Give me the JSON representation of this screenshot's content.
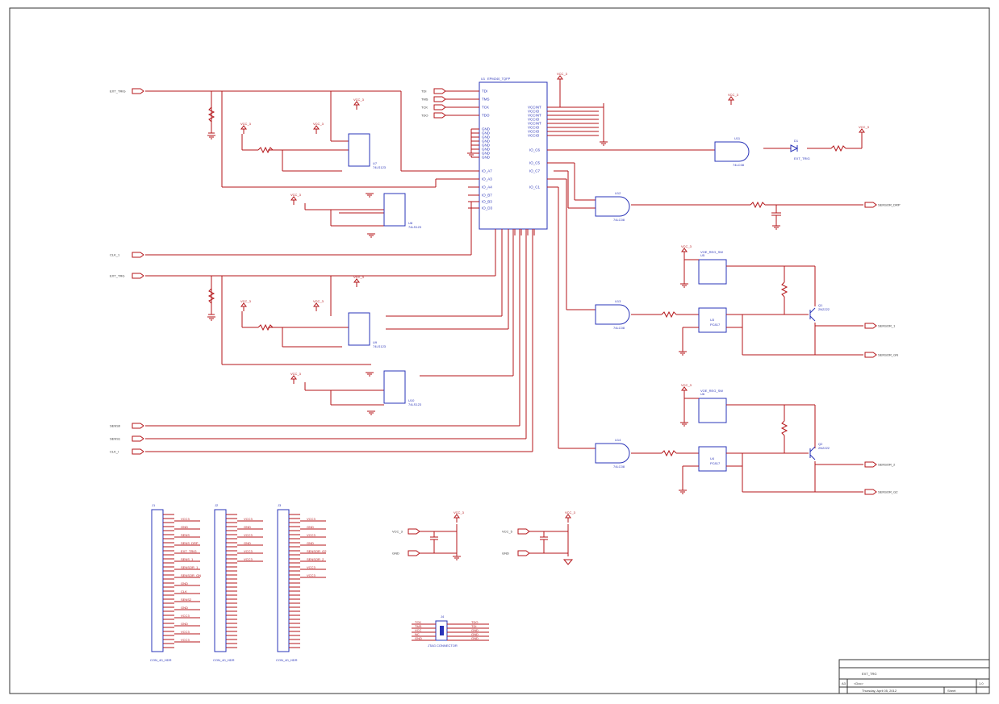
{
  "schematic": {
    "fpga": {
      "designator": "U1",
      "part": "EPM240_TQFP",
      "jtag_pins": [
        "TDI",
        "TMS",
        "TCK",
        "TDO"
      ],
      "vccint_labels": [
        "VCCINT",
        "VCCIO",
        "VCCINT",
        "VCCIO",
        "VCCINT",
        "VCCIO",
        "VCCIO",
        "VCCIO"
      ],
      "gnd_labels": [
        "GND",
        "GND",
        "GND",
        "GND",
        "GND",
        "GND",
        "GND",
        "GND"
      ],
      "io_labels": [
        "IO_C6",
        "IO_C5",
        "IO_C7",
        "IO_C1",
        "IO_A7",
        "IO_A3",
        "IO_A4",
        "IO_B7",
        "IO_B3",
        "IO_D3"
      ]
    },
    "left_ports": [
      {
        "name": "EXT_TRIG"
      },
      {
        "name": "CLK_1"
      },
      {
        "name": "EXT_TRG"
      },
      {
        "name": "SENS0"
      },
      {
        "name": "SENS1"
      },
      {
        "name": "CLK_I"
      }
    ],
    "jtag_ports": [
      "TDI",
      "TMS",
      "TCK",
      "TDO"
    ],
    "right_ports": [
      {
        "name": "SENSOR_DRP"
      },
      {
        "name": "SENSOR_1"
      },
      {
        "name": "SENSOR_GN"
      },
      {
        "name": "SENSOR_2"
      },
      {
        "name": "SENSOR_G2"
      }
    ],
    "power_labels": {
      "vcc": "VCC_3",
      "vcc_alt": "VCC_5",
      "gnd": "GND"
    },
    "gates": [
      {
        "ref": "U11",
        "part": "74LC08"
      },
      {
        "ref": "U12",
        "part": "74LC08"
      },
      {
        "ref": "U13",
        "part": "74LC08"
      },
      {
        "ref": "U14",
        "part": "74LC08"
      }
    ],
    "ics_left": [
      {
        "ref": "U7",
        "part": "74LS123"
      },
      {
        "ref": "U8",
        "part": "74LS123"
      },
      {
        "ref": "U9",
        "part": "74LS123"
      },
      {
        "ref": "U10",
        "part": "74LS123"
      }
    ],
    "regulators": [
      {
        "ref": "U5",
        "part": "VOE_REG_SW"
      },
      {
        "ref": "U6",
        "part": "VOE_REG_SW"
      }
    ],
    "transistors": [
      {
        "ref": "Q1",
        "part": "2N2222"
      },
      {
        "ref": "Q2",
        "part": "2N2222"
      }
    ],
    "optos": [
      {
        "ref": "U3",
        "part": "PC817"
      },
      {
        "ref": "U4",
        "part": "PC817"
      }
    ],
    "led": {
      "ref": "D1",
      "label": "EXT_TRIG"
    },
    "connectors": [
      {
        "ref": "J1",
        "part": "CON_40_HDR"
      },
      {
        "ref": "J2",
        "part": "CON_40_HDR"
      },
      {
        "ref": "J3",
        "part": "CON_40_HDR"
      }
    ],
    "jtag_connector": {
      "ref": "J4",
      "part": "JTAG CONNECTOR"
    },
    "connector_signals_1": [
      "VCC3",
      "GND",
      "SENS",
      "SENS_DRP",
      "EXT_TRIG",
      "SENS_1",
      "SENSOR_1",
      "SENSOR_GN",
      "GND",
      "CLK",
      "SENS2",
      "GND",
      "VCC3",
      "GND",
      "VCC3",
      "VCC3"
    ],
    "connector_signals_2": [
      "VCC3",
      "GND",
      "VCC3",
      "GND",
      "VCC3",
      "VCC3"
    ],
    "connector_signals_3": [
      "VCC3",
      "GND",
      "VCC3",
      "GND",
      "SENSOR_G2",
      "SENSOR_2",
      "VCC3",
      "VCC3"
    ],
    "jtag_signals": [
      "TCK",
      "TDO",
      "TMS",
      "TDI",
      "VCC",
      "GND",
      "NC",
      "GND",
      "GND",
      "GND"
    ],
    "title_block": {
      "title": "EXT_TRG",
      "doc": "<Doc>",
      "size": "A3",
      "date": "Thursday, April 05, 2012",
      "sheet_label": "Sheet",
      "rev": "1.0"
    }
  }
}
